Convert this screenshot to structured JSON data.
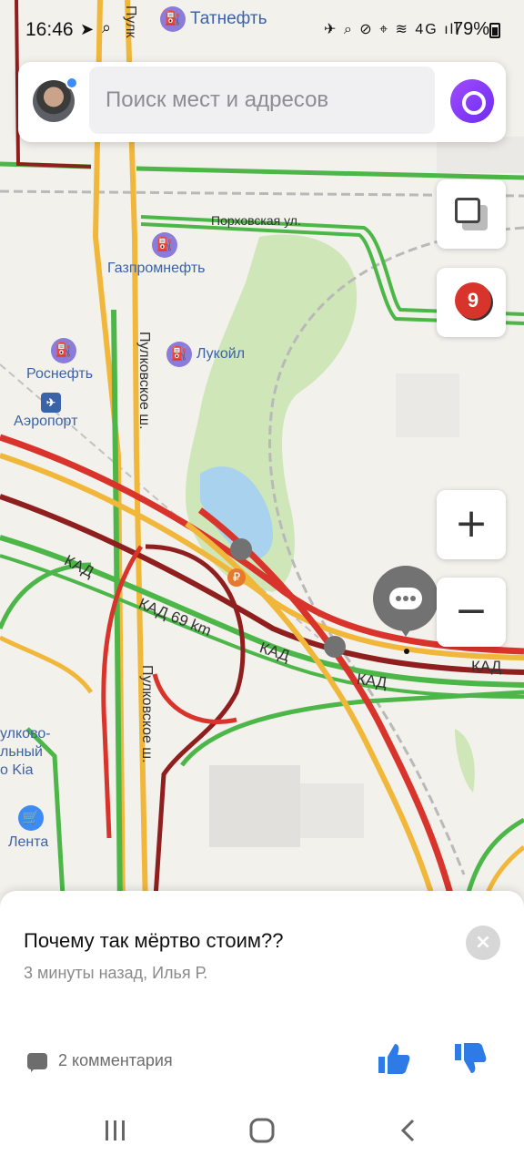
{
  "status_bar": {
    "time": "16:46",
    "icons": "✈ ⌕ ⊘ ⌖ ≋ 4G ıll",
    "battery": "79%"
  },
  "search": {
    "placeholder": "Поиск мест и адресов"
  },
  "map": {
    "traffic_level": "9",
    "zoom_in": "+",
    "zoom_out": "−",
    "pois": [
      {
        "label": "Татнефть",
        "glyph": "⛽"
      },
      {
        "label": "Газпромнефть",
        "glyph": "⛽"
      },
      {
        "label": "Роснефть",
        "glyph": "⛽"
      },
      {
        "label": "Лукойл",
        "glyph": "⛽"
      },
      {
        "label": "Аэропорт",
        "glyph": "✈"
      },
      {
        "label": "Лента",
        "glyph": "🛒"
      },
      {
        "label": "улково-\nльный\nо Kia",
        "glyph": ""
      }
    ],
    "streets": {
      "porkhovskaya": "Порховская ул.",
      "pulkovskoe_top": "Пулк",
      "pulkovskoe_mid": "Пулковское ш.",
      "pulkovskoe_low": "Пулковское ш.",
      "kad_1": "КАД",
      "kad_69": "КАД 69 km",
      "kad_2": "КАД",
      "kad_3": "КАД",
      "kad_4": "КАД"
    }
  },
  "post": {
    "title": "Почему так мёртво стоим??",
    "meta": "3 минуты назад, Илья Р.",
    "comments": "2 комментария",
    "close": "×"
  },
  "colors": {
    "jam_red": "#d8342c",
    "jam_dark": "#8f1e1e",
    "slow_yellow": "#f1b73a",
    "free_green": "#4cb748",
    "accent_purple": "#7a3cf5"
  }
}
